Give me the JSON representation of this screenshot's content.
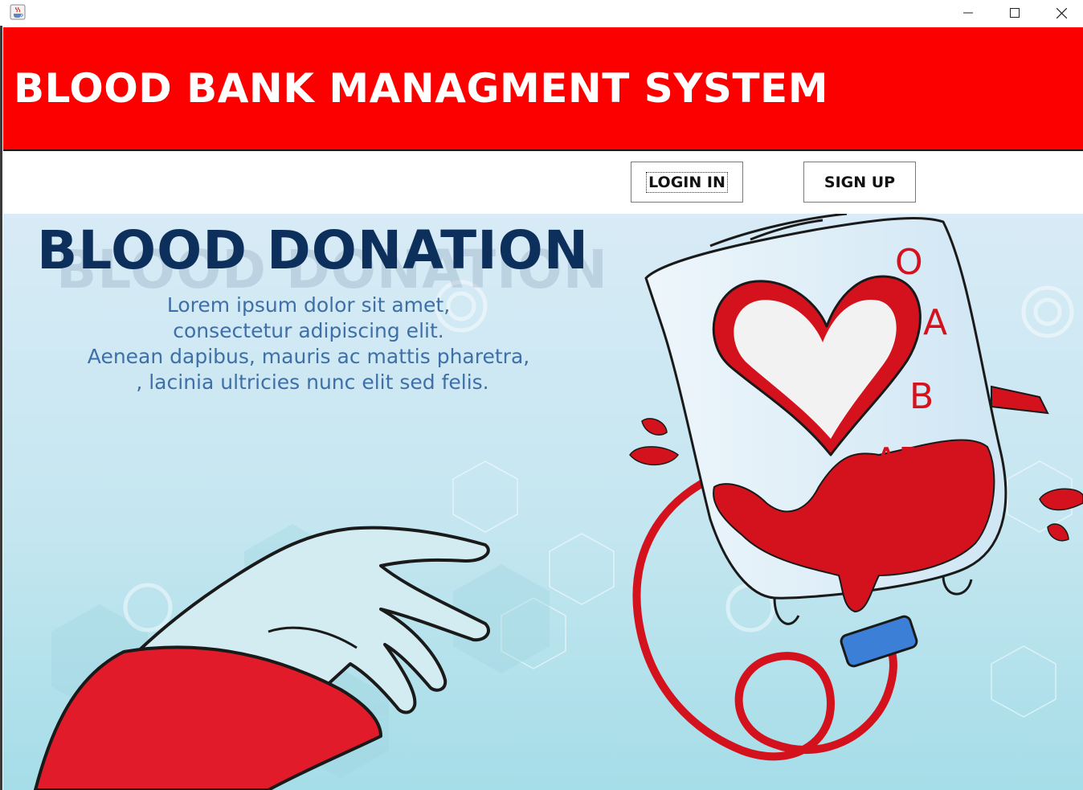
{
  "window": {
    "app_icon": "java-cup-icon",
    "controls": {
      "minimize": "minimize-icon",
      "maximize": "maximize-icon",
      "close": "close-icon"
    }
  },
  "header": {
    "title": "BLOOD BANK MANAGMENT SYSTEM",
    "background": "#fc0000"
  },
  "actions": {
    "login_label": "LOGIN IN",
    "signup_label": "SIGN UP"
  },
  "banner": {
    "heading": "BLOOD DONATION",
    "body_lines": [
      "Lorem ipsum dolor sit amet,",
      "consectetur adipiscing elit.",
      "Aenean dapibus, mauris ac mattis pharetra,",
      ", lacinia ultricies nunc elit sed felis."
    ],
    "blood_types": [
      "O",
      "A",
      "B",
      "AB+"
    ],
    "colors": {
      "heading": "#0d2f5c",
      "body": "#3e6fa8",
      "blood": "#e1101c",
      "bg_top": "#d6eaf5",
      "bg_bottom": "#a8e0ea"
    }
  }
}
